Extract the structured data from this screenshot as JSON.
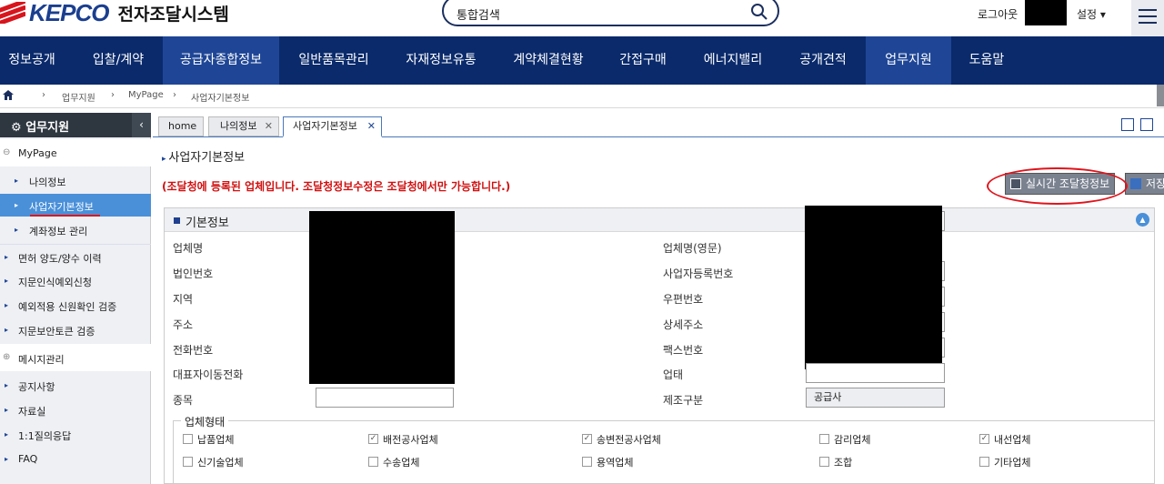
{
  "header": {
    "brand": "KEPCO",
    "system": "전자조달시스템",
    "search_placeholder": "통합검색",
    "logout": "로그아웃",
    "settings": "설정 ▾"
  },
  "gnb": [
    "정보공개",
    "입찰/계약",
    "공급자종합정보",
    "일반품목관리",
    "자재정보유통",
    "계약체결현황",
    "간접구매",
    "에너지밸리",
    "공개견적",
    "업무지원",
    "도움말"
  ],
  "breadcrumb": [
    "업무지원",
    "MyPage",
    "사업자기본정보"
  ],
  "sidebar": {
    "title": "업무지원",
    "collapse": "‹",
    "items": [
      "MyPage",
      "나의정보",
      "사업자기본정보",
      "계좌정보 관리",
      "면허 양도/양수 이력",
      "지문인식예외신청",
      "예외적용 신원확인 검증",
      "지문보안토큰 검증",
      "메시지관리",
      "공지사항",
      "자료실",
      "1:1질의응답",
      "FAQ"
    ]
  },
  "tabs": [
    {
      "label": "home"
    },
    {
      "label": "나의정보",
      "close": "✕"
    },
    {
      "label": "사업자기본정보",
      "close": "✕"
    }
  ],
  "page": {
    "title": "사업자기본정보",
    "notice": "(조달청에 등록된 업체입니다. 조달청정보수정은 조달청에서만 가능합니다.)",
    "btn_realtime": "실시간 조달청정보",
    "btn_save": "저장"
  },
  "basic": {
    "title": "기본정보",
    "left_labels": [
      "업체명",
      "법인번호",
      "지역",
      "주소",
      "전화번호",
      "대표자이동전화",
      "종목"
    ],
    "right_labels": [
      "업체명(영문)",
      "사업자등록번호",
      "우편번호",
      "상세주소",
      "팩스번호",
      "업태",
      "제조구분"
    ],
    "manufacture_value": "공급사"
  },
  "biz_type": {
    "title": "업체형태",
    "options": [
      {
        "label": "납품업체",
        "checked": false
      },
      {
        "label": "배전공사업체",
        "checked": true
      },
      {
        "label": "송변전공사업체",
        "checked": true
      },
      {
        "label": "감리업체",
        "checked": false
      },
      {
        "label": "내선업체",
        "checked": true
      },
      {
        "label": "신기술업체",
        "checked": false
      },
      {
        "label": "수송업체",
        "checked": false
      },
      {
        "label": "용역업체",
        "checked": false
      },
      {
        "label": "조합",
        "checked": false
      },
      {
        "label": "기타업체",
        "checked": false
      }
    ]
  },
  "colors": {
    "nav": "#0a2a6b",
    "nav_active": "#1f4696",
    "accent": "#4a90d9",
    "alert": "#d01010"
  }
}
